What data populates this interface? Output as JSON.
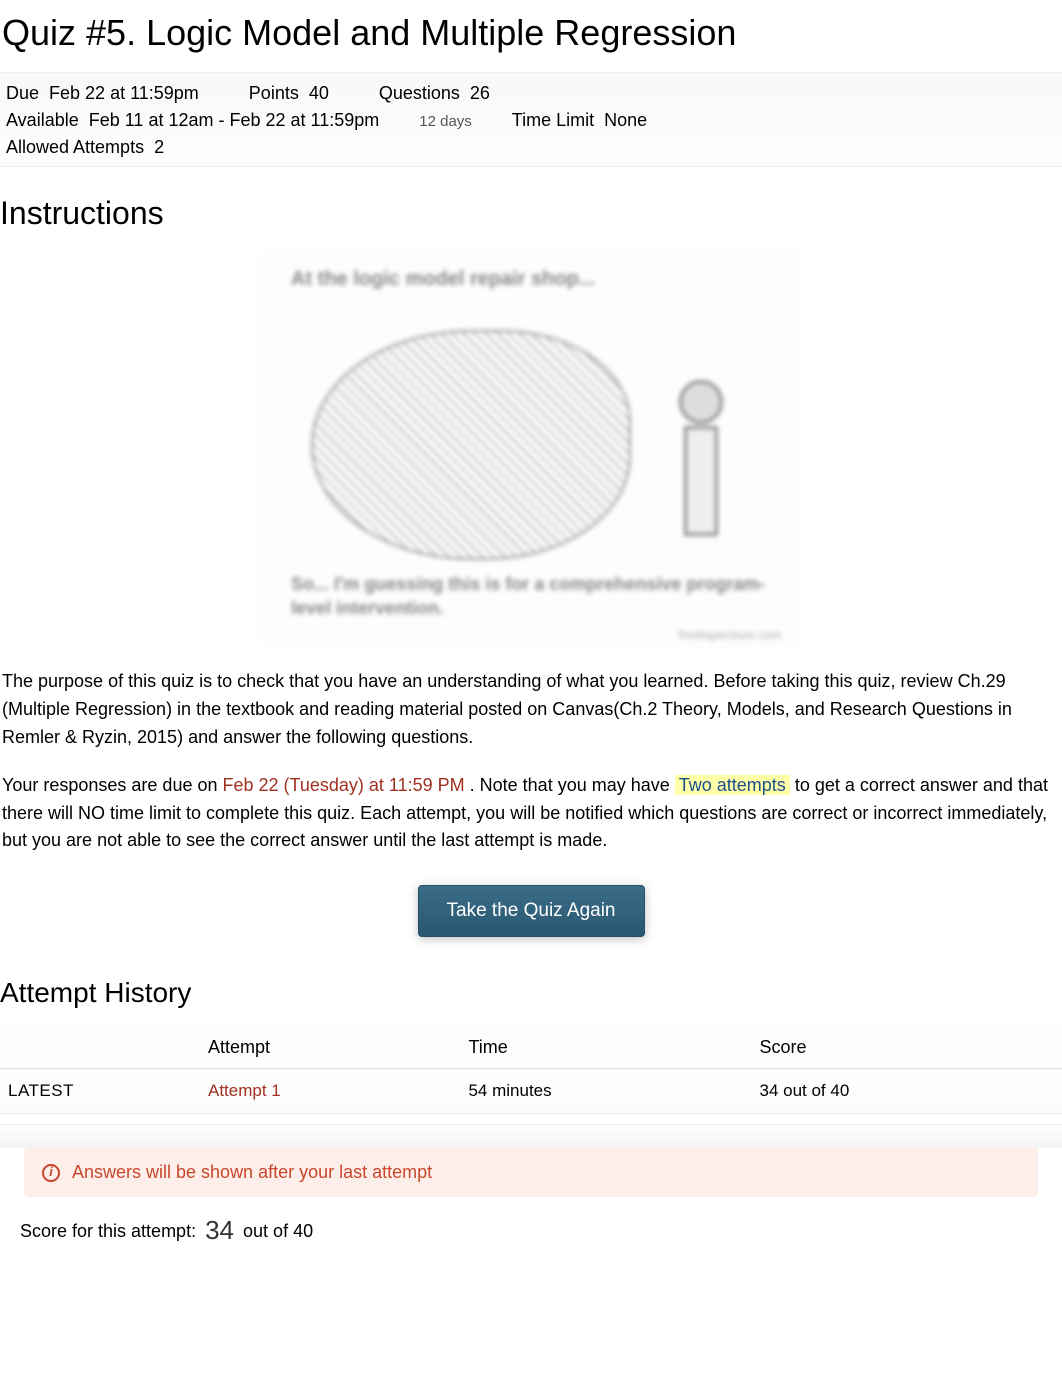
{
  "title": "Quiz #5. Logic Model and Multiple Regression",
  "meta": {
    "due_label": "Due",
    "due_value": "Feb 22 at 11:59pm",
    "points_label": "Points",
    "points_value": "40",
    "questions_label": "Questions",
    "questions_value": "26",
    "available_label": "Available",
    "available_value": "Feb 11 at 12am - Feb 22 at 11:59pm",
    "available_duration": "12 days",
    "timelimit_label": "Time Limit",
    "timelimit_value": "None",
    "attempts_label": "Allowed Attempts",
    "attempts_value": "2"
  },
  "instructions_heading": "Instructions",
  "cartoon": {
    "caption_top": "At the logic model repair shop...",
    "caption_bottom": "So... I'm guessing this is for a comprehensive program-level intervention.",
    "credit": "freshspectrum.com"
  },
  "para1": "The purpose of this quiz is to check that you have an understanding of what you learned. Before taking this quiz, review Ch.29 (Multiple Regression) in the textbook and reading material posted on Canvas(Ch.2 Theory, Models, and Research Questions in Remler & Ryzin, 2015) and answer the following questions.",
  "para2_pre": "Your responses are due on ",
  "para2_due": "Feb 22 (Tuesday) at 11:59 PM",
  "para2_mid": ". Note that you may have ",
  "para2_attempts": "Two attempts",
  "para2_post": " to get a correct answer and that there will NO time limit to complete this quiz. Each attempt, you will be notified which questions are correct or incorrect immediately, but you are not able to see the correct answer until the last attempt is made.",
  "take_quiz_label": "Take the Quiz Again",
  "history_heading": "Attempt History",
  "table": {
    "headers": {
      "attempt": "Attempt",
      "time": "Time",
      "score": "Score"
    },
    "rows": [
      {
        "tag": "LATEST",
        "attempt": "Attempt 1",
        "time": "54 minutes",
        "score": "34 out of 40"
      }
    ]
  },
  "banner_text": "Answers will be shown after your last attempt",
  "score_line": {
    "label": "Score for this attempt:",
    "value": "34",
    "suffix": "out of 40"
  }
}
